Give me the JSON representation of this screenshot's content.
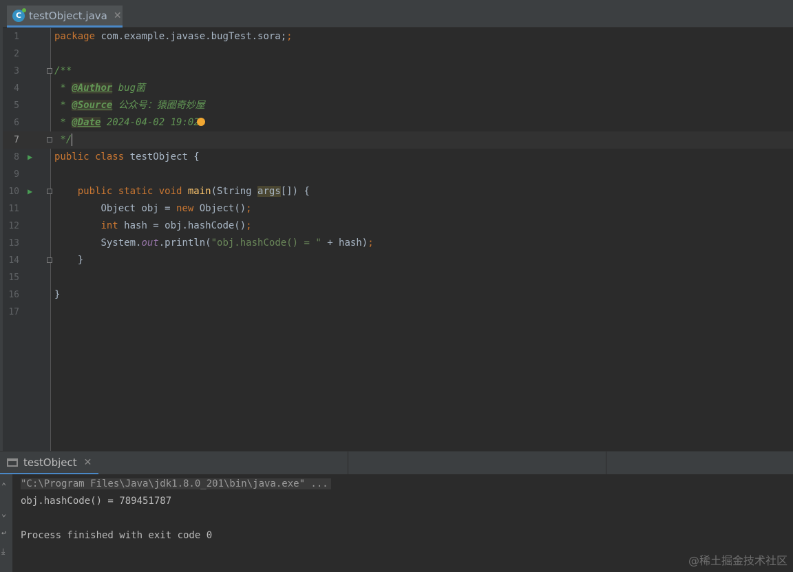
{
  "editor_tab": {
    "filename": "testObject.java",
    "close": "✕"
  },
  "code_lines": [
    {
      "num": "1"
    },
    {
      "num": "2"
    },
    {
      "num": "3"
    },
    {
      "num": "4"
    },
    {
      "num": "5"
    },
    {
      "num": "6"
    },
    {
      "num": "7"
    },
    {
      "num": "8"
    },
    {
      "num": "9"
    },
    {
      "num": "10"
    },
    {
      "num": "11"
    },
    {
      "num": "12"
    },
    {
      "num": "13"
    },
    {
      "num": "14"
    },
    {
      "num": "15"
    },
    {
      "num": "16"
    },
    {
      "num": "17"
    }
  ],
  "code": {
    "l1_kw": "package",
    "l1_rest": " com.example.javase.bugTest.sora;",
    "l3": "/**",
    "l4_star": " * ",
    "l4_tag": "@Author",
    "l4_val": " bug菌",
    "l5_tag": "@Source",
    "l5_val": " 公众号：猿圈奇妙屋",
    "l6_tag": "@Date",
    "l6_val": " 2024-04-02 19:02",
    "l7": " */",
    "l8_kw": "public class",
    "l8_rest": " testObject {",
    "l10_kw1": "public static void",
    "l10_fn": "main",
    "l10_p1": "(String ",
    "l10_arg": "args",
    "l10_p2": "[]) {",
    "l11_a": "Object obj = ",
    "l11_kw": "new",
    "l11_b": " Object()",
    "l11_semi": ";",
    "l12_kw": "int",
    "l12_rest": " hash = obj.hashCode()",
    "l12_semi": ";",
    "l13_a": "System.",
    "l13_fld": "out",
    "l13_b": ".println(",
    "l13_str": "\"obj.hashCode() = \"",
    "l13_c": " + hash)",
    "l13_semi": ";",
    "l14": "}",
    "l16": "}"
  },
  "console": {
    "tab_label": "testObject",
    "close": "✕",
    "command": "\"C:\\Program Files\\Java\\jdk1.8.0_201\\bin\\java.exe\" ...",
    "output": "obj.hashCode() = 789451787",
    "exit": "Process finished with exit code 0"
  },
  "watermark": "@稀土掘金技术社区",
  "colors": {
    "keyword": "#cc7832",
    "comment": "#629755",
    "function": "#ffc66d",
    "string": "#6a8759",
    "field": "#9876aa",
    "text": "#a9b7c6",
    "background": "#2b2b2b",
    "accent": "#4a88c7"
  },
  "icons": {
    "file": "java-class-icon",
    "run": "run-gutter-icon",
    "fold": "fold-icon",
    "intention": "lightbulb-icon",
    "console": "console-icon"
  }
}
